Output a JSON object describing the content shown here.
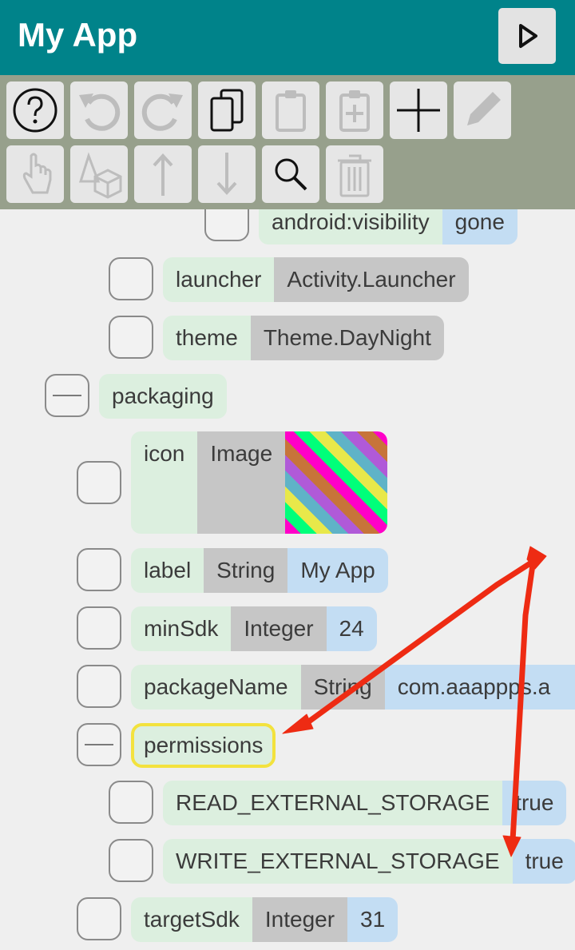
{
  "app": {
    "title": "My App"
  },
  "toolbar": {
    "row1": [
      "help-icon",
      "undo-icon",
      "redo-icon",
      "copy-icon",
      "paste-icon",
      "paste-add-icon",
      "add-icon",
      "edit-icon"
    ],
    "row2": [
      "pointer-icon",
      "shapes-icon",
      "move-up-icon",
      "move-down-icon",
      "search-icon",
      "delete-icon"
    ]
  },
  "tree": {
    "visibility": {
      "key": "android:visibility",
      "value": "gone"
    },
    "launcher": {
      "key": "launcher",
      "type": "Activity.Launcher"
    },
    "theme": {
      "key": "theme",
      "type": "Theme.DayNight"
    },
    "packaging": {
      "key": "packaging"
    },
    "icon": {
      "key": "icon",
      "type": "Image"
    },
    "label": {
      "key": "label",
      "type": "String",
      "value": "My App"
    },
    "minSdk": {
      "key": "minSdk",
      "type": "Integer",
      "value": "24"
    },
    "packageName": {
      "key": "packageName",
      "type": "String",
      "value": "com.aaappps.a"
    },
    "permissions": {
      "key": "permissions"
    },
    "read": {
      "key": "READ_EXTERNAL_STORAGE",
      "value": "true"
    },
    "write": {
      "key": "WRITE_EXTERNAL_STORAGE",
      "value": "true"
    },
    "targetSdk": {
      "key": "targetSdk",
      "type": "Integer",
      "value": "31"
    }
  },
  "colors": {
    "appbar": "#00838a",
    "toolbar": "#97a08c",
    "annotation": "#ee2b13",
    "selection": "#f3e23d"
  }
}
